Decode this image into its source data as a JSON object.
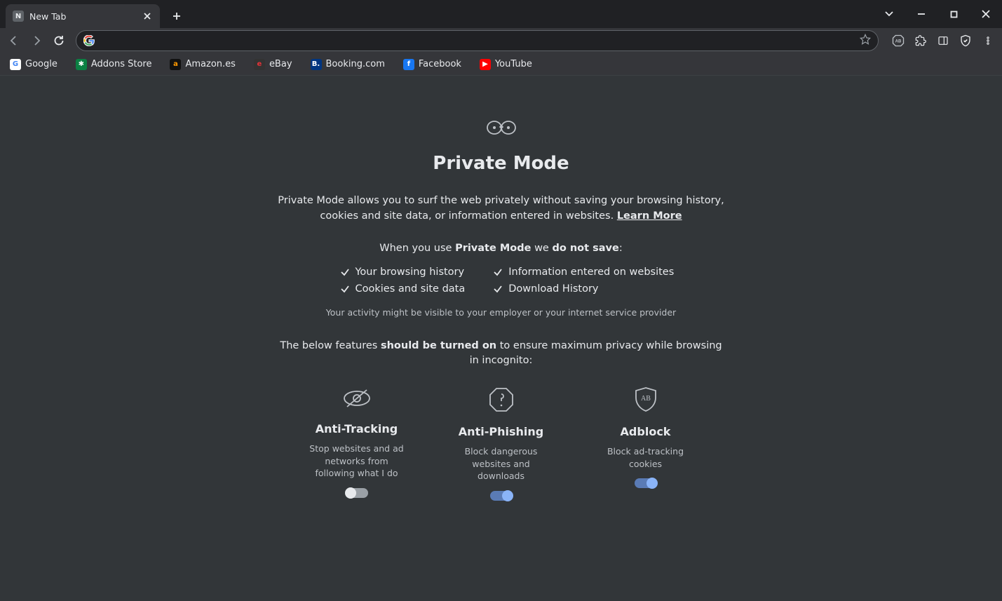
{
  "tab": {
    "title": "New Tab",
    "favicon_letter": "N"
  },
  "omnibox": {
    "value": "",
    "placeholder": ""
  },
  "bookmarks": [
    {
      "label": "Google",
      "icon_text": "G",
      "icon_bg": "#ffffff",
      "icon_fg": "#4285F4"
    },
    {
      "label": "Addons Store",
      "icon_text": "✱",
      "icon_bg": "#0b8043",
      "icon_fg": "#ffffff"
    },
    {
      "label": "Amazon.es",
      "icon_text": "a",
      "icon_bg": "#111111",
      "icon_fg": "#ff9900"
    },
    {
      "label": "eBay",
      "icon_text": "e",
      "icon_bg": "#333333",
      "icon_fg": "#e53238"
    },
    {
      "label": "Booking.com",
      "icon_text": "B.",
      "icon_bg": "#003580",
      "icon_fg": "#ffffff"
    },
    {
      "label": "Facebook",
      "icon_text": "f",
      "icon_bg": "#1877f2",
      "icon_fg": "#ffffff"
    },
    {
      "label": "YouTube",
      "icon_text": "▶",
      "icon_bg": "#ff0000",
      "icon_fg": "#ffffff"
    }
  ],
  "page": {
    "title": "Private Mode",
    "desc_before": "Private Mode allows you to surf the web privately without saving your browsing history, cookies and site data, or information entered in websites. ",
    "learn_more": "Learn More",
    "line2_before": "When you use ",
    "line2_mid": "Private Mode",
    "line2_after_we": " we ",
    "line2_after_bold": "do not save",
    "line2_end": ":",
    "checks": [
      "Your browsing history",
      "Information entered on websites",
      "Cookies and site data",
      "Download History"
    ],
    "disclaimer": "Your activity might be visible to your employer or your internet service provider",
    "features_before": "The below features ",
    "features_bold": "should be turned on",
    "features_after": " to ensure maximum privacy while browsing in incognito:",
    "features": [
      {
        "title": "Anti-Tracking",
        "desc": "Stop websites and ad networks from following what I do",
        "enabled": false
      },
      {
        "title": "Anti-Phishing",
        "desc": "Block dangerous websites and downloads",
        "enabled": true
      },
      {
        "title": "Adblock",
        "desc": "Block ad-tracking cookies",
        "enabled": true
      }
    ]
  }
}
